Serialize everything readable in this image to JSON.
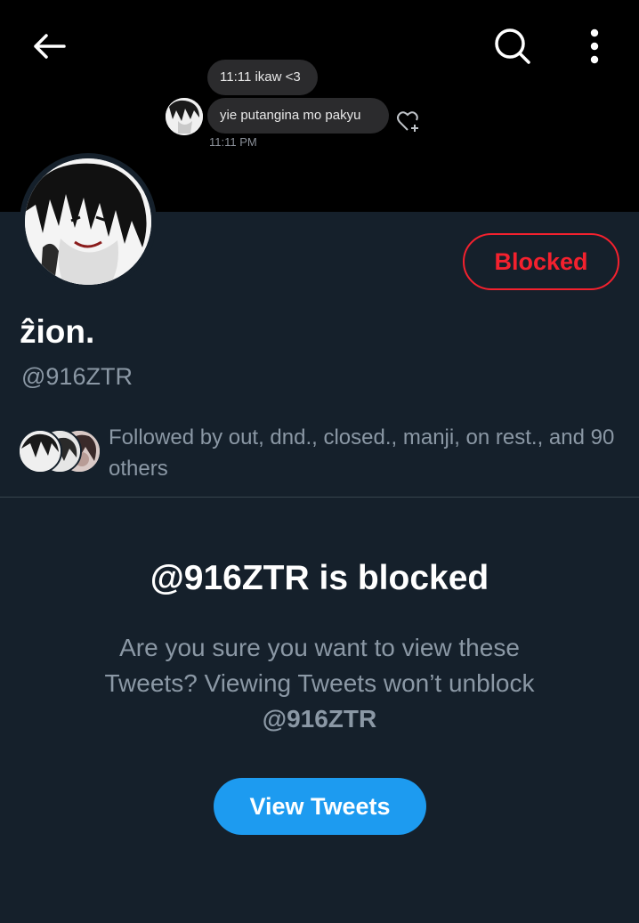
{
  "header": {
    "back_icon": "arrow-left-icon",
    "search_icon": "search-icon",
    "more_icon": "more-vertical-icon"
  },
  "banner_chat": {
    "message_1": "11:11 ikaw <3",
    "message_2": "yie putangina mo pakyu",
    "time": "11:11 PM",
    "reaction_icon": "heart-plus-icon"
  },
  "profile": {
    "display_name": "ẑion.",
    "handle": "@916ZTR",
    "blocked_label": "Blocked",
    "followed_by": "Followed by out, dnd., closed., manji, on rest., and 90 others"
  },
  "blocked_notice": {
    "title": "@916ZTR is blocked",
    "description": "Are you sure you want to view these Tweets? Viewing Tweets won’t unblock",
    "handle": "@916ZTR",
    "button_label": "View Tweets"
  },
  "colors": {
    "background": "#15202b",
    "banner": "#000000",
    "accent_blue": "#1d9bf0",
    "blocked_red": "#f4212e",
    "secondary_text": "#8b98a5"
  }
}
